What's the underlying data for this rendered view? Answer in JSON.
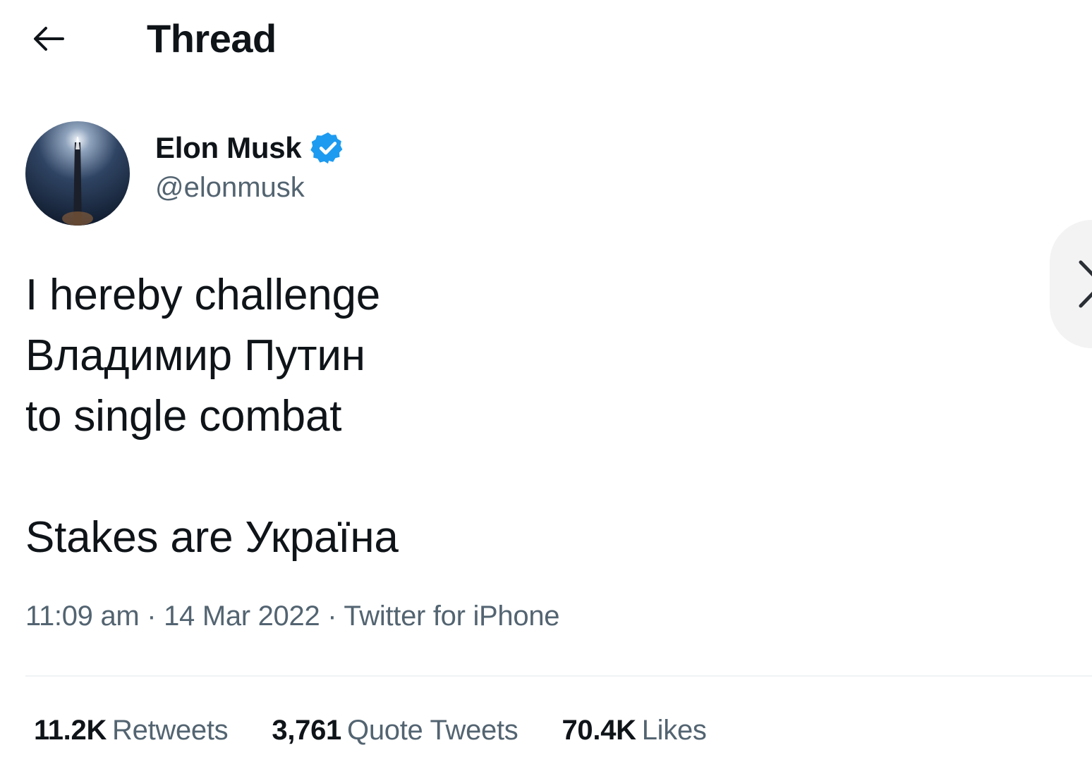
{
  "header": {
    "back_icon": "arrow-left-icon",
    "title": "Thread"
  },
  "tweet": {
    "author": {
      "display_name": "Elon Musk",
      "handle": "@elonmusk",
      "verified_icon": "verified-badge-icon",
      "verified_color": "#1d9bf0"
    },
    "text_lines": [
      "I hereby challenge",
      "Владимир Путин",
      "to single combat",
      "",
      "Stakes are Україна"
    ],
    "time": "11:09 am",
    "separator": "·",
    "date": "14 Mar 2022",
    "source": "Twitter for iPhone",
    "stats": [
      {
        "count": "11.2K",
        "label": "Retweets"
      },
      {
        "count": "3,761",
        "label": "Quote Tweets"
      },
      {
        "count": "70.4K",
        "label": "Likes"
      }
    ]
  },
  "nav": {
    "next_icon": "chevron-right-icon"
  },
  "colors": {
    "text_primary": "#0f1419",
    "text_secondary": "#536471",
    "verified": "#1d9bf0",
    "divider": "#eff3f4"
  }
}
